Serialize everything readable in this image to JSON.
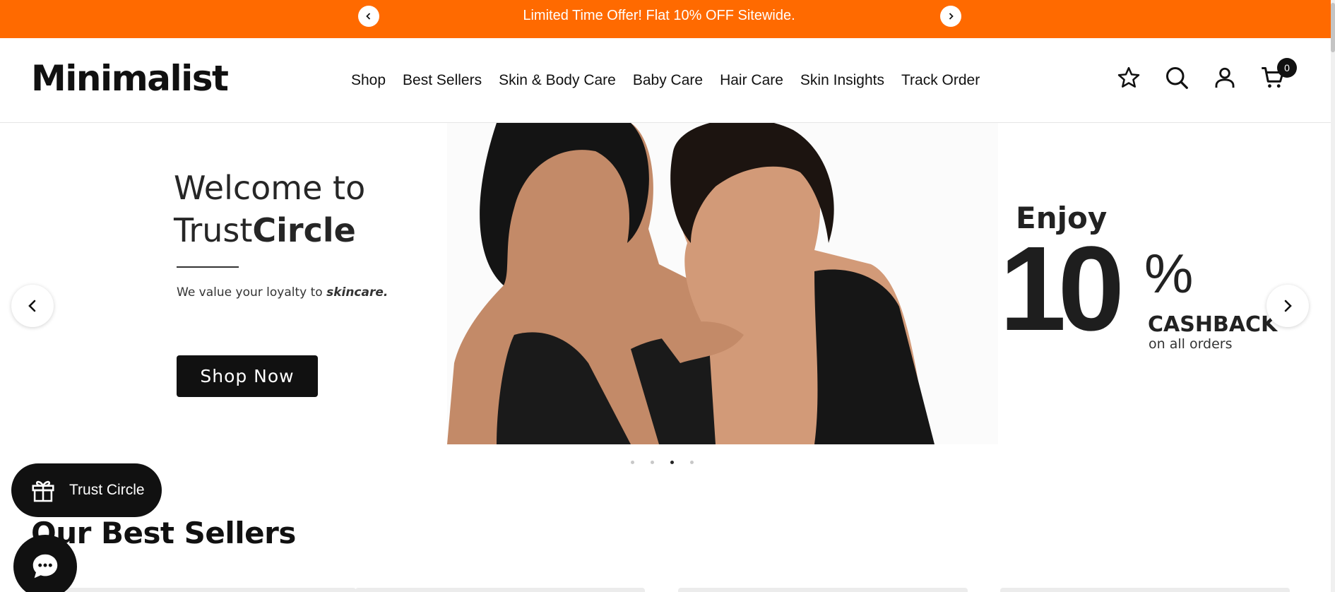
{
  "announcement": {
    "text": "Limited Time Offer! Flat 10% OFF Sitewide.",
    "prev_icon": "chevron-left-icon",
    "next_icon": "chevron-right-icon",
    "bg_color": "#ff6a00"
  },
  "header": {
    "logo": "Minimalist",
    "nav": [
      {
        "label": "Shop"
      },
      {
        "label": "Best Sellers"
      },
      {
        "label": "Skin & Body Care"
      },
      {
        "label": "Baby Care"
      },
      {
        "label": "Hair Care"
      },
      {
        "label": "Skin Insights"
      },
      {
        "label": "Track Order"
      }
    ],
    "icons": [
      "star-icon",
      "search-icon",
      "account-icon",
      "cart-icon"
    ],
    "cart_count": "0"
  },
  "hero": {
    "welcome_line1": "Welcome to",
    "welcome_trust": "Trust",
    "welcome_circle": "Circle",
    "tagline_prefix": "We value your loyalty to ",
    "tagline_emphasis": "skincare.",
    "cta_label": "Shop Now",
    "enjoy": "Enjoy",
    "big_number": "10",
    "percent": "%",
    "cashback": "CASHBACK",
    "cashback_sub": "on all orders",
    "slide_count": 4,
    "active_slide": 3
  },
  "best_sellers": {
    "title": "Our Best Sellers"
  },
  "widgets": {
    "trust_circle_label": "Trust Circle",
    "trust_icon": "gift-icon",
    "chat_icon": "chat-bubble-icon"
  }
}
